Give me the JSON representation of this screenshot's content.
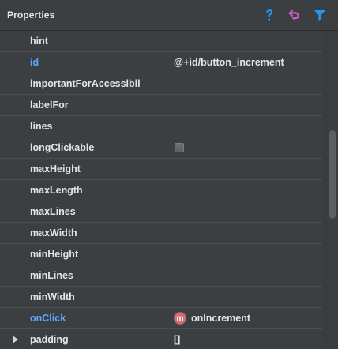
{
  "panel": {
    "title": "Properties",
    "icons": {
      "help": "help-icon",
      "undo": "undo-icon",
      "filter": "filter-icon"
    },
    "colors": {
      "accent_blue": "#2196f3",
      "accent_pink": "#d65cc4",
      "property_blue": "#5aa7ff",
      "badge_red": "#d06f6f"
    }
  },
  "properties": [
    {
      "name": "hint",
      "value": ""
    },
    {
      "name": "id",
      "value": "@+id/button_increment"
    },
    {
      "name": "importantForAccessibil",
      "value": ""
    },
    {
      "name": "labelFor",
      "value": ""
    },
    {
      "name": "lines",
      "value": ""
    },
    {
      "name": "longClickable",
      "value": ""
    },
    {
      "name": "maxHeight",
      "value": ""
    },
    {
      "name": "maxLength",
      "value": ""
    },
    {
      "name": "maxLines",
      "value": ""
    },
    {
      "name": "maxWidth",
      "value": ""
    },
    {
      "name": "minHeight",
      "value": ""
    },
    {
      "name": "minLines",
      "value": ""
    },
    {
      "name": "minWidth",
      "value": ""
    },
    {
      "name": "onClick",
      "value": "onIncrement",
      "badge": "m"
    },
    {
      "name": "padding",
      "value": "[]"
    }
  ]
}
